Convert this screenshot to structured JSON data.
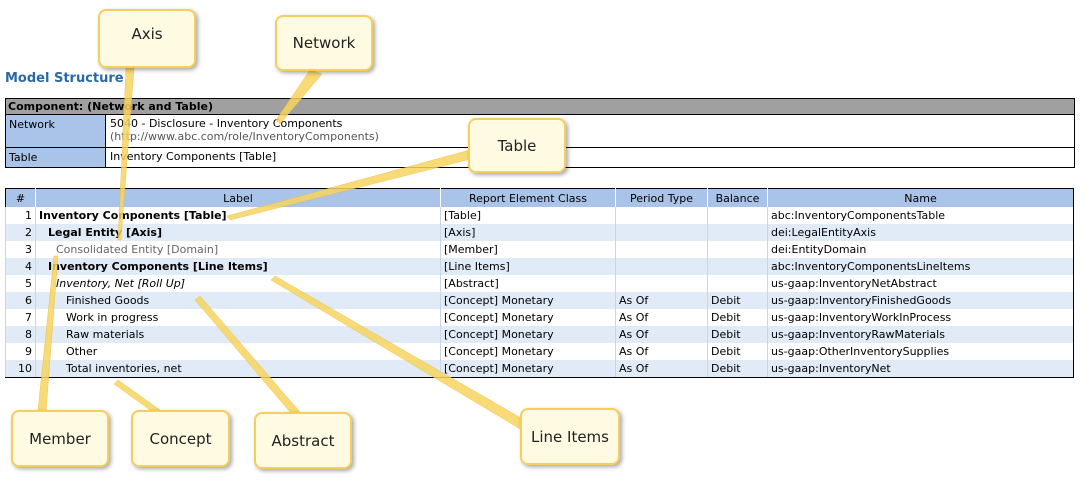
{
  "title": "Model Structure",
  "component": {
    "header": "Component: (Network and Table)",
    "network_label": "Network",
    "network_value": "5040 - Disclosure - Inventory Components",
    "network_uri": "(http://www.abc.com/role/InventoryComponents)",
    "table_label": "Table",
    "table_value": "Inventory Components [Table]"
  },
  "table": {
    "headers": [
      "#",
      "Label",
      "Report Element Class",
      "Period Type",
      "Balance",
      "Name"
    ],
    "rows": [
      {
        "n": "1",
        "label": "Inventory Components [Table]",
        "cls": "[Table]",
        "period": "",
        "balance": "",
        "name": "abc:InventoryComponentsTable"
      },
      {
        "n": "2",
        "label": "Legal Entity [Axis]",
        "cls": "[Axis]",
        "period": "",
        "balance": "",
        "name": "dei:LegalEntityAxis"
      },
      {
        "n": "3",
        "label": "Consolidated Entity [Domain]",
        "cls": "[Member]",
        "period": "",
        "balance": "",
        "name": "dei:EntityDomain"
      },
      {
        "n": "4",
        "label": "Inventory Components [Line Items]",
        "cls": "[Line Items]",
        "period": "",
        "balance": "",
        "name": "abc:InventoryComponentsLineItems"
      },
      {
        "n": "5",
        "label": "Inventory, Net [Roll Up]",
        "cls": "[Abstract]",
        "period": "",
        "balance": "",
        "name": "us-gaap:InventoryNetAbstract"
      },
      {
        "n": "6",
        "label": "Finished Goods",
        "cls": "[Concept] Monetary",
        "period": "As Of",
        "balance": "Debit",
        "name": "us-gaap:InventoryFinishedGoods"
      },
      {
        "n": "7",
        "label": "Work in progress",
        "cls": "[Concept] Monetary",
        "period": "As Of",
        "balance": "Debit",
        "name": "us-gaap:InventoryWorkInProcess"
      },
      {
        "n": "8",
        "label": "Raw materials",
        "cls": "[Concept] Monetary",
        "period": "As Of",
        "balance": "Debit",
        "name": "us-gaap:InventoryRawMaterials"
      },
      {
        "n": "9",
        "label": "Other",
        "cls": "[Concept] Monetary",
        "period": "As Of",
        "balance": "Debit",
        "name": "us-gaap:OtherInventorySupplies"
      },
      {
        "n": "10",
        "label": "Total inventories, net",
        "cls": "[Concept] Monetary",
        "period": "As Of",
        "balance": "Debit",
        "name": "us-gaap:InventoryNet"
      }
    ]
  },
  "callouts": {
    "axis": "Axis",
    "network": "Network",
    "table": "Table",
    "member": "Member",
    "concept": "Concept",
    "abstract": "Abstract",
    "line_items": "Line Items"
  }
}
